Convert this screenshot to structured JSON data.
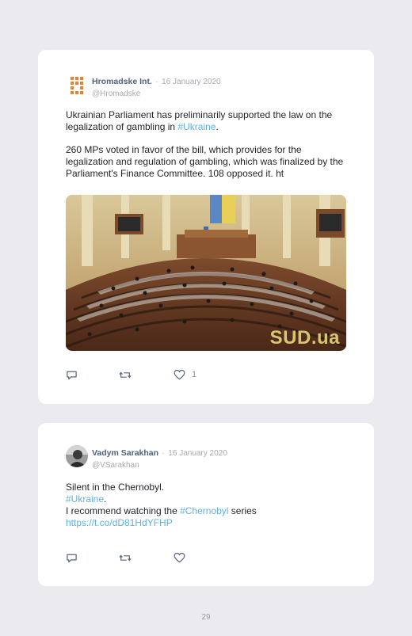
{
  "tweets": [
    {
      "author": "Hromadske Int.",
      "separator": "·",
      "date": "16 January 2020",
      "handle": "@Hromadske",
      "text_p1_before": "Ukrainian Parliament has preliminarily supported the law on the legalization of gambling in ",
      "text_p1_hashtag": "#Ukraine",
      "text_p1_after": ".",
      "text_p2": "260 MPs voted in favor of the bill, which provides for the legalization and regulation of gambling, which was finalized by the Parliament's Finance Committee. 108 opposed it. ht",
      "image": {
        "watermark": "SUD.ua"
      },
      "likes": "1"
    },
    {
      "author": "Vadym Sarakhan",
      "separator": "·",
      "date": "16 January 2020",
      "handle": "@VSarakhan",
      "line1": "Silent in the Chernobyl.",
      "line2_hashtag": "#Ukraine",
      "line2_after": ".",
      "line3_before": "I recommend watching the ",
      "line3_hashtag": "#Chernobyl",
      "line3_after": " series",
      "line4_link": "https://t.co/dD81HdYFHP"
    }
  ],
  "icons": {
    "reply": "reply-icon",
    "retweet": "retweet-icon",
    "like": "heart-icon",
    "logo": "hromadske-logo-icon",
    "avatar": "vadym-avatar"
  },
  "colors": {
    "link": "#5fb0e8",
    "author": "#51607a",
    "logo": "#f07e2e"
  },
  "page_number": "29"
}
